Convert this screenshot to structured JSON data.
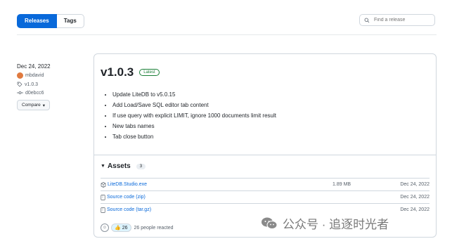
{
  "tabs": {
    "releases": "Releases",
    "tags": "Tags"
  },
  "search": {
    "placeholder": "Find a release"
  },
  "release": {
    "date": "Dec 24, 2022",
    "author": "mbdavid",
    "tag": "v1.0.3",
    "commit": "d0ebcc6",
    "compare_label": "Compare",
    "version": "v1.0.3",
    "latest_badge": "Latest",
    "notes": [
      "Update LiteDB to v5.0.15",
      "Add Load/Save SQL editor tab content",
      "If use query with explicit LIMIT, ignore 1000 documents limit result",
      "New tabs names",
      "Tab close button"
    ]
  },
  "assets": {
    "title": "Assets",
    "count": "3",
    "items": [
      {
        "name": "LiteDB.Studio.exe",
        "size": "1.89 MB",
        "date": "Dec 24, 2022"
      },
      {
        "name": "Source code (zip)",
        "size": "",
        "date": "Dec 24, 2022"
      },
      {
        "name": "Source code (tar.gz)",
        "size": "",
        "date": "Dec 24, 2022"
      }
    ]
  },
  "reactions": {
    "count": "26",
    "text": "26 people reacted"
  },
  "watermark": {
    "text": "公众号 · 追逐时光者"
  },
  "colors": {
    "accent": "#0969da",
    "latest_green": "#1a7f37",
    "border": "#d0d7de"
  }
}
